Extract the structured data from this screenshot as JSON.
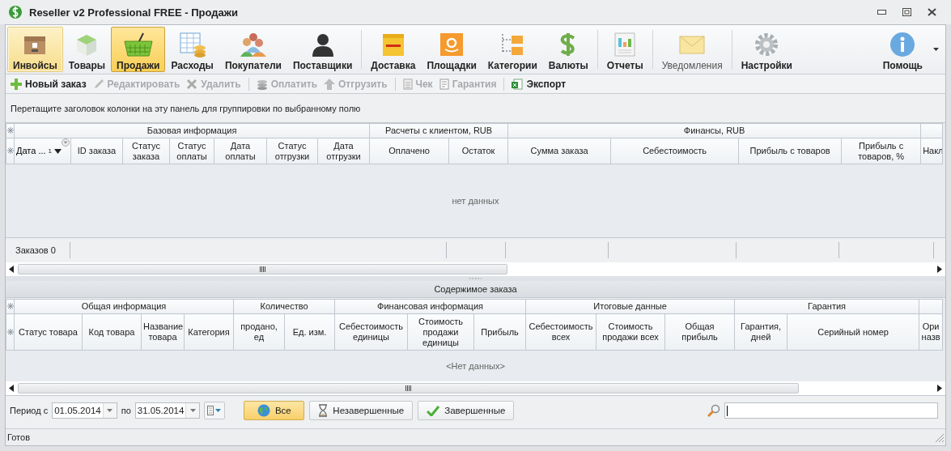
{
  "window": {
    "title": "Reseller v2 Professional FREE - Продажи"
  },
  "ribbon": {
    "groups": [
      {
        "items": [
          {
            "label": "Инвойсы",
            "selected": false,
            "highlighted": true,
            "disabled": false
          },
          {
            "label": "Товары",
            "selected": false,
            "highlighted": false,
            "disabled": false
          },
          {
            "label": "Продажи",
            "selected": true,
            "highlighted": false,
            "disabled": false
          },
          {
            "label": "Расходы",
            "selected": false,
            "highlighted": false,
            "disabled": false
          },
          {
            "label": "Покупатели",
            "selected": false,
            "highlighted": false,
            "disabled": false
          },
          {
            "label": "Поставщики",
            "selected": false,
            "highlighted": false,
            "disabled": false
          }
        ]
      },
      {
        "items": [
          {
            "label": "Доставка",
            "selected": false,
            "highlighted": false,
            "disabled": false
          },
          {
            "label": "Площадки",
            "selected": false,
            "highlighted": false,
            "disabled": false
          },
          {
            "label": "Категории",
            "selected": false,
            "highlighted": false,
            "disabled": false
          },
          {
            "label": "Валюты",
            "selected": false,
            "highlighted": false,
            "disabled": false
          }
        ]
      },
      {
        "items": [
          {
            "label": "Отчеты",
            "selected": false,
            "highlighted": false,
            "disabled": false
          }
        ]
      },
      {
        "items": [
          {
            "label": "Уведомления",
            "selected": false,
            "highlighted": false,
            "disabled": true
          }
        ]
      },
      {
        "items": [
          {
            "label": "Настройки",
            "selected": false,
            "highlighted": false,
            "disabled": false
          }
        ]
      }
    ],
    "help": {
      "label": "Помощь"
    }
  },
  "toolbar": {
    "groups": [
      {
        "items": [
          {
            "label": "Новый заказ",
            "disabled": false
          },
          {
            "label": "Редактировать",
            "disabled": true
          },
          {
            "label": "Удалить",
            "disabled": true
          }
        ]
      },
      {
        "items": [
          {
            "label": "Оплатить",
            "disabled": true
          },
          {
            "label": "Отгрузить",
            "disabled": true
          }
        ]
      },
      {
        "items": [
          {
            "label": "Чек",
            "disabled": true
          },
          {
            "label": "Гарантия",
            "disabled": true
          }
        ]
      },
      {
        "items": [
          {
            "label": "Экспорт",
            "disabled": false
          }
        ]
      }
    ]
  },
  "group_panel": {
    "hint": "Перетащите заголовок колонки на эту панель для группировки по выбранному полю"
  },
  "orders_grid": {
    "bands": [
      {
        "label": "Базовая информация",
        "columns": [
          {
            "label": "Дата ...",
            "sort_descending": true,
            "sort_index": "1"
          },
          {
            "label": "ID заказа"
          },
          {
            "label": "Статус заказа"
          },
          {
            "label": "Статус оплаты"
          },
          {
            "label": "Дата оплаты"
          },
          {
            "label": "Статус отгрузки"
          },
          {
            "label": "Дата отгрузки"
          }
        ]
      },
      {
        "label": "Расчеты с клиентом, RUB",
        "columns": [
          {
            "label": "Оплачено"
          },
          {
            "label": "Остаток"
          }
        ]
      },
      {
        "label": "Финансы, RUB",
        "columns": [
          {
            "label": "Сумма заказа"
          },
          {
            "label": "Себестоимость"
          },
          {
            "label": "Прибыль с товаров"
          },
          {
            "label": "Прибыль с товаров, %"
          }
        ]
      },
      {
        "columns": [
          {
            "label": "Накл"
          }
        ]
      }
    ],
    "empty_text": "нет данных",
    "footer": "Заказов 0"
  },
  "details_panel": {
    "title": "Содержимое заказа"
  },
  "items_grid": {
    "bands": [
      {
        "label": "Общая информация",
        "columns": [
          {
            "label": "Статус товара"
          },
          {
            "label": "Код товара"
          },
          {
            "label": "Название товара"
          },
          {
            "label": "Категория"
          }
        ]
      },
      {
        "label": "Количество",
        "columns": [
          {
            "label": "продано, ед"
          },
          {
            "label": "Ед. изм."
          }
        ]
      },
      {
        "label": "Финансовая информация",
        "columns": [
          {
            "label": "Себестоимость единицы"
          },
          {
            "label": "Стоимость продажи единицы"
          },
          {
            "label": "Прибыль"
          }
        ]
      },
      {
        "label": "Итоговые данные",
        "columns": [
          {
            "label": "Себестоимость всех"
          },
          {
            "label": "Стоимость продажи всех"
          },
          {
            "label": "Общая прибыль"
          }
        ]
      },
      {
        "label": "Гарантия",
        "columns": [
          {
            "label": "Гарантия, дней"
          },
          {
            "label": "Серийный номер"
          }
        ]
      },
      {
        "columns": [
          {
            "label": "Ори назв"
          }
        ]
      }
    ],
    "empty_text": "<Нет данных>"
  },
  "filter_bar": {
    "period_label": "Период с",
    "date_from": {
      "value": "01.05.2014"
    },
    "to_label": "по",
    "date_to": {
      "value": "31.05.2014"
    },
    "buttons": [
      {
        "label": "Все",
        "selected": true
      },
      {
        "label": "Незавершенные",
        "selected": false
      },
      {
        "label": "Завершенные",
        "selected": false
      }
    ]
  },
  "status_bar": {
    "text": "Готов"
  }
}
